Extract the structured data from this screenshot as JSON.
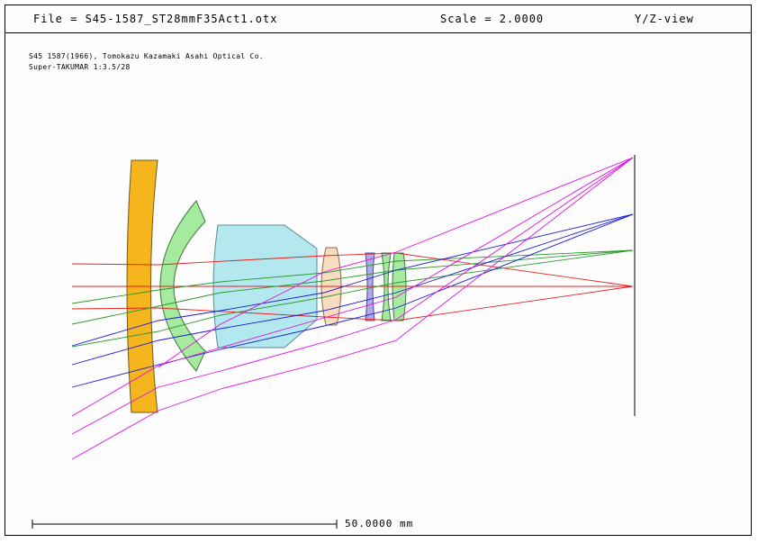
{
  "header": {
    "file": "File = S45-1587_ST28mmF35Act1.otx",
    "scale": "Scale = 2.0000",
    "view": "Y/Z-view"
  },
  "description": {
    "line1": "S45 1587(1966), Tomokazu Kazamaki Asahi Optical Co.",
    "line2": "Super-TAKUMAR 1:3.5/28"
  },
  "scale_bar": {
    "label": "50.0000 mm"
  },
  "colors": {
    "element_orange": "#f5b51c",
    "element_green": "#a6eaa0",
    "element_cyan": "#b4e8ef",
    "element_peach": "#f8dcc0",
    "element_violet": "#b0aae6",
    "ray_red": "#e82020",
    "ray_green": "#2a9a2a",
    "ray_blue": "#1a1ad8",
    "ray_magenta": "#e010e0"
  }
}
